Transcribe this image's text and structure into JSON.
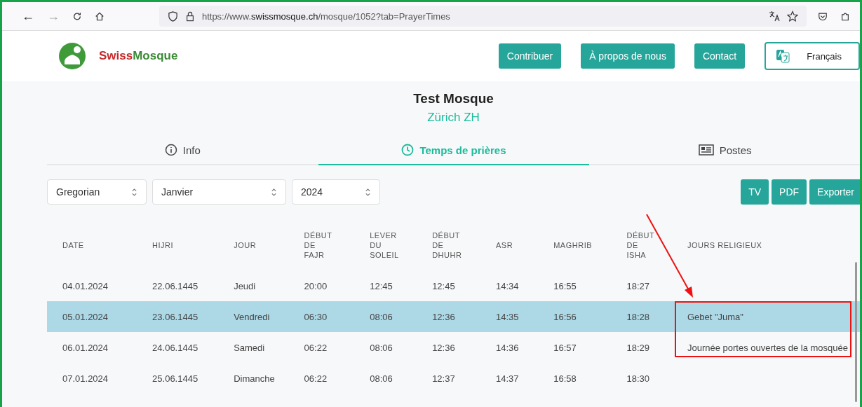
{
  "browser": {
    "back": "←",
    "forward": "→",
    "url_prefix": "https://www.",
    "url_domain": "swissmosque.ch",
    "url_path": "/mosque/1052?tab=PrayerTimes"
  },
  "header": {
    "logo_first": "Swiss",
    "logo_second": "Mosque",
    "nav": [
      "Contribuer",
      "À propos de nous",
      "Contact"
    ],
    "language": "Français"
  },
  "mosque": {
    "name": "Test Mosque",
    "location": "Zürich ZH"
  },
  "tabs": [
    {
      "label": "Info",
      "selected": false
    },
    {
      "label": "Temps de prières",
      "selected": true
    },
    {
      "label": "Postes",
      "selected": false
    }
  ],
  "filters": [
    {
      "value": "Gregorian"
    },
    {
      "value": "Janvier"
    },
    {
      "value": "2024"
    }
  ],
  "actions": [
    "TV",
    "PDF",
    "Exporter"
  ],
  "table": {
    "columns": [
      "DATE",
      "HIJRI",
      "JOUR",
      "DÉBUT DE FAJR",
      "LEVER DU SOLEIL",
      "DÉBUT DE DHUHR",
      "ASR",
      "MAGHRIB",
      "DÉBUT DE ISHA",
      "JOURS RELIGIEUX"
    ],
    "rows": [
      {
        "selected": false,
        "cells": [
          "04.01.2024",
          "22.06.1445",
          "Jeudi",
          "20:00",
          "12:45",
          "12:45",
          "14:34",
          "16:55",
          "18:27"
        ]
      },
      {
        "selected": true,
        "cells": [
          "05.01.2024",
          "23.06.1445",
          "Vendredi",
          "06:30",
          "08:06",
          "12:36",
          "14:35",
          "16:56",
          "18:28"
        ],
        "religious": "Gebet \"Juma\""
      },
      {
        "selected": false,
        "cells": [
          "06.01.2024",
          "24.06.1445",
          "Samedi",
          "06:22",
          "08:06",
          "12:36",
          "14:36",
          "16:57",
          "18:29"
        ],
        "religious": "Journée portes ouvertes de la mosquée"
      },
      {
        "selected": false,
        "cells": [
          "07.01.2024",
          "25.06.1445",
          "Dimanche",
          "06:22",
          "08:06",
          "12:37",
          "14:37",
          "16:58",
          "18:30"
        ]
      }
    ]
  }
}
